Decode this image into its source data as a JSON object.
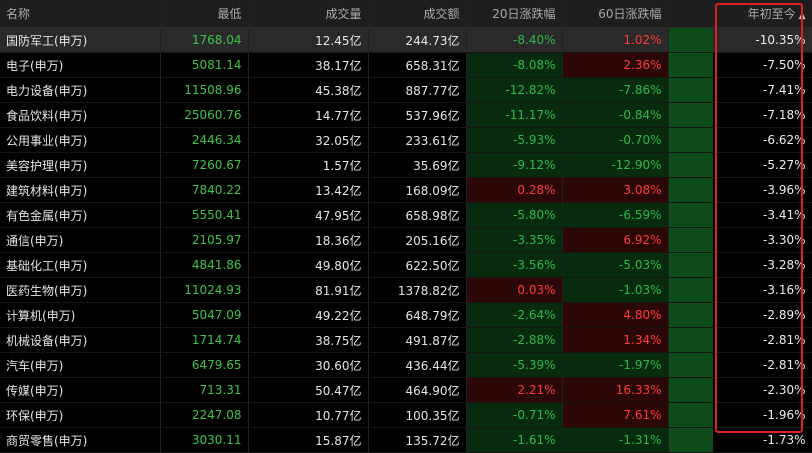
{
  "columns": {
    "name": "名称",
    "low": "最低",
    "volume": "成交量",
    "turnover": "成交额",
    "chg20": "20日涨跌幅",
    "chg60": "60日涨跌幅",
    "ytd": "年初至今"
  },
  "sort": {
    "column": "ytd",
    "direction": "desc",
    "icon": "sort-triangle-up-icon"
  },
  "colors": {
    "up": "#ff3b3b",
    "down": "#2fb94a",
    "highlight": "#e02020"
  },
  "rows": [
    {
      "name": "国防军工(申万)",
      "low": "1768.04",
      "volume": "12.45亿",
      "turnover": "244.73亿",
      "chg20": "-8.40%",
      "chg60": "1.02%",
      "ytd": "-10.35%"
    },
    {
      "name": "电子(申万)",
      "low": "5081.14",
      "volume": "38.17亿",
      "turnover": "658.31亿",
      "chg20": "-8.08%",
      "chg60": "2.36%",
      "ytd": "-7.50%"
    },
    {
      "name": "电力设备(申万)",
      "low": "11508.96",
      "volume": "45.38亿",
      "turnover": "887.77亿",
      "chg20": "-12.82%",
      "chg60": "-7.86%",
      "ytd": "-7.41%"
    },
    {
      "name": "食品饮料(申万)",
      "low": "25060.76",
      "volume": "14.77亿",
      "turnover": "537.96亿",
      "chg20": "-11.17%",
      "chg60": "-0.84%",
      "ytd": "-7.18%"
    },
    {
      "name": "公用事业(申万)",
      "low": "2446.34",
      "volume": "32.05亿",
      "turnover": "233.61亿",
      "chg20": "-5.93%",
      "chg60": "-0.70%",
      "ytd": "-6.62%"
    },
    {
      "name": "美容护理(申万)",
      "low": "7260.67",
      "volume": "1.57亿",
      "turnover": "35.69亿",
      "chg20": "-9.12%",
      "chg60": "-12.90%",
      "ytd": "-5.27%"
    },
    {
      "name": "建筑材料(申万)",
      "low": "7840.22",
      "volume": "13.42亿",
      "turnover": "168.09亿",
      "chg20": "0.28%",
      "chg60": "3.08%",
      "ytd": "-3.96%"
    },
    {
      "name": "有色金属(申万)",
      "low": "5550.41",
      "volume": "47.95亿",
      "turnover": "658.98亿",
      "chg20": "-5.80%",
      "chg60": "-6.59%",
      "ytd": "-3.41%"
    },
    {
      "name": "通信(申万)",
      "low": "2105.97",
      "volume": "18.36亿",
      "turnover": "205.16亿",
      "chg20": "-3.35%",
      "chg60": "6.92%",
      "ytd": "-3.30%"
    },
    {
      "name": "基础化工(申万)",
      "low": "4841.86",
      "volume": "49.80亿",
      "turnover": "622.50亿",
      "chg20": "-3.56%",
      "chg60": "-5.03%",
      "ytd": "-3.28%"
    },
    {
      "name": "医药生物(申万)",
      "low": "11024.93",
      "volume": "81.91亿",
      "turnover": "1378.82亿",
      "chg20": "0.03%",
      "chg60": "-1.03%",
      "ytd": "-3.16%"
    },
    {
      "name": "计算机(申万)",
      "low": "5047.09",
      "volume": "49.22亿",
      "turnover": "648.79亿",
      "chg20": "-2.64%",
      "chg60": "4.80%",
      "ytd": "-2.89%"
    },
    {
      "name": "机械设备(申万)",
      "low": "1714.74",
      "volume": "38.75亿",
      "turnover": "491.87亿",
      "chg20": "-2.88%",
      "chg60": "1.34%",
      "ytd": "-2.81%"
    },
    {
      "name": "汽车(申万)",
      "low": "6479.65",
      "volume": "30.60亿",
      "turnover": "436.44亿",
      "chg20": "-5.39%",
      "chg60": "-1.97%",
      "ytd": "-2.81%"
    },
    {
      "name": "传媒(申万)",
      "low": "713.31",
      "volume": "50.47亿",
      "turnover": "464.90亿",
      "chg20": "2.21%",
      "chg60": "16.33%",
      "ytd": "-2.30%"
    },
    {
      "name": "环保(申万)",
      "low": "2247.08",
      "volume": "10.77亿",
      "turnover": "100.35亿",
      "chg20": "-0.71%",
      "chg60": "7.61%",
      "ytd": "-1.96%"
    },
    {
      "name": "商贸零售(申万)",
      "low": "3030.11",
      "volume": "15.87亿",
      "turnover": "135.72亿",
      "chg20": "-1.61%",
      "chg60": "-1.31%",
      "ytd": "-1.73%"
    }
  ]
}
